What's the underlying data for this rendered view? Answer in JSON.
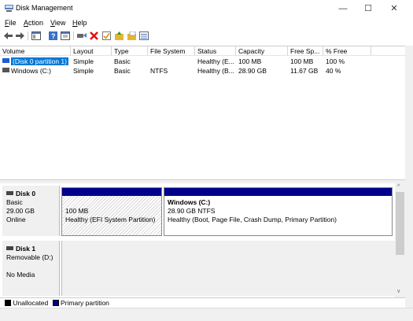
{
  "window": {
    "title": "Disk Management",
    "minimize": "—",
    "maximize": "☐",
    "close": "✕"
  },
  "menu": {
    "items": [
      {
        "label": "File",
        "accel": "F",
        "rest": "ile"
      },
      {
        "label": "Action",
        "accel": "A",
        "rest": "ction"
      },
      {
        "label": "View",
        "accel": "V",
        "rest": "iew"
      },
      {
        "label": "Help",
        "accel": "H",
        "rest": "elp"
      }
    ]
  },
  "toolbar": {
    "icons": [
      "back-arrow-icon",
      "forward-arrow-icon",
      "console-tree-icon",
      "help-icon",
      "properties-icon",
      "connect-icon",
      "delete-icon",
      "check-icon",
      "folder-up-icon",
      "folder-open-icon",
      "list-view-icon"
    ]
  },
  "volume_list": {
    "columns": [
      "Volume",
      "Layout",
      "Type",
      "File System",
      "Status",
      "Capacity",
      "Free Sp...",
      "% Free"
    ],
    "rows": [
      [
        "(Disk 0 partition 1)",
        "Simple",
        "Basic",
        "",
        "Healthy (E...",
        "100 MB",
        "100 MB",
        "100 %"
      ],
      [
        "Windows (C:)",
        "Simple",
        "Basic",
        "NTFS",
        "Healthy (B...",
        "28.90 GB",
        "11.67 GB",
        "40 %"
      ]
    ],
    "selected_row": 0,
    "colors": {
      "selection": "#0078d7",
      "volume_icon_blue": "#1e5bd6"
    }
  },
  "disks": [
    {
      "name": "Disk 0",
      "kind": "Basic",
      "size": "29.00 GB",
      "state": "Online",
      "partitions": [
        {
          "title": "",
          "size_line": "100 MB",
          "status_line": "Healthy (EFI System Partition)"
        },
        {
          "title": "Windows  (C:)",
          "size_line": "28.90 GB NTFS",
          "status_line": "Healthy (Boot, Page File, Crash Dump, Primary Partition)"
        }
      ]
    },
    {
      "name": "Disk 1",
      "kind": "Removable (D:)",
      "size": "",
      "state": "No Media",
      "partitions": []
    }
  ],
  "legend": {
    "items": [
      {
        "label": "Unallocated",
        "color": "#000000"
      },
      {
        "label": "Primary partition",
        "color": "#00008b"
      }
    ]
  }
}
